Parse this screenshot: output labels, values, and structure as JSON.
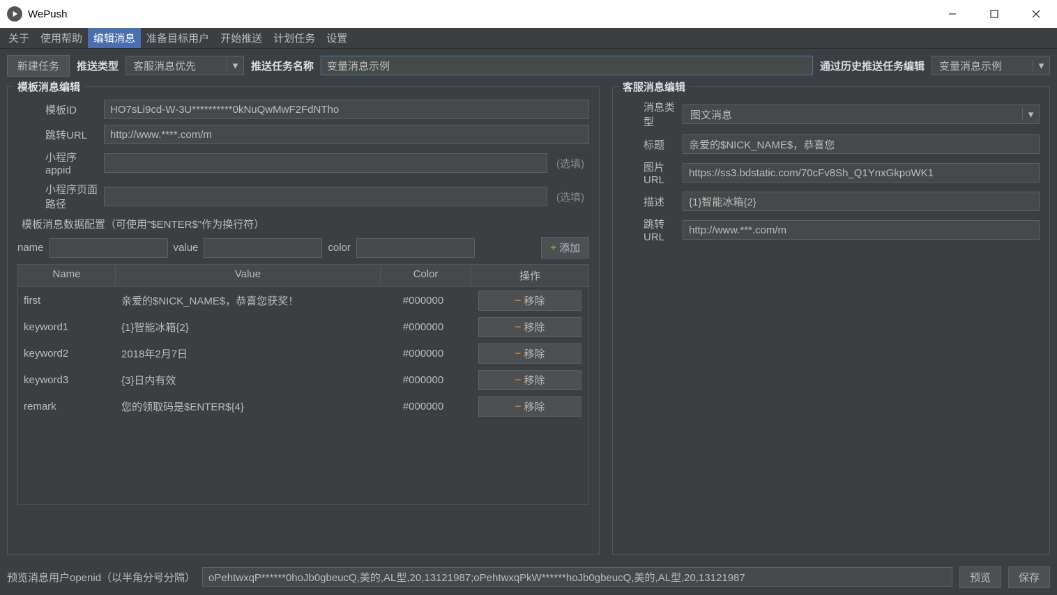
{
  "app": {
    "title": "WePush"
  },
  "menu": {
    "items": [
      "关于",
      "使用帮助",
      "编辑消息",
      "准备目标用户",
      "开始推送",
      "计划任务",
      "设置"
    ],
    "activeIndex": 2
  },
  "toolbar": {
    "new_task": "新建任务",
    "push_type_label": "推送类型",
    "push_type_value": "客服消息优先",
    "task_name_label": "推送任务名称",
    "task_name_value": "变量消息示例",
    "history_label": "通过历史推送任务编辑",
    "history_value": "变量消息示例"
  },
  "template_panel": {
    "title": "模板消息编辑",
    "template_id_label": "模板ID",
    "template_id_value": "HO7sLi9cd-W-3U**********0kNuQwMwF2FdNTho",
    "redirect_url_label": "跳转URL",
    "redirect_url_value": "http://www.****.com/m",
    "mini_appid_label": "小程序appid",
    "mini_appid_value": "",
    "mini_appid_hint": "(选填)",
    "mini_path_label": "小程序页面路径",
    "mini_path_value": "",
    "mini_path_hint": "(选填)",
    "config_title": "模板消息数据配置（可使用\"$ENTER$\"作为换行符）",
    "name_label": "name",
    "value_label": "value",
    "color_label": "color",
    "add_btn": "添加",
    "table": {
      "headers": {
        "name": "Name",
        "value": "Value",
        "color": "Color",
        "op": "操作"
      },
      "remove_label": "移除",
      "rows": [
        {
          "name": "first",
          "value": "亲爱的$NICK_NAME$，恭喜您获奖！",
          "color": "#000000"
        },
        {
          "name": "keyword1",
          "value": "{1}智能冰箱{2}",
          "color": "#000000"
        },
        {
          "name": "keyword2",
          "value": "2018年2月7日",
          "color": "#000000"
        },
        {
          "name": "keyword3",
          "value": "{3}日内有效",
          "color": "#000000"
        },
        {
          "name": "remark",
          "value": "您的领取码是$ENTER${4}",
          "color": "#000000"
        }
      ]
    }
  },
  "service_panel": {
    "title": "客服消息编辑",
    "msg_type_label": "消息类型",
    "msg_type_value": "图文消息",
    "title_label": "标题",
    "title_value": "亲爱的$NICK_NAME$，恭喜您",
    "pic_url_label": "图片URL",
    "pic_url_value": "https://ss3.bdstatic.com/70cFv8Sh_Q1YnxGkpoWK1",
    "desc_label": "描述",
    "desc_value": "{1}智能冰箱{2}",
    "redirect_url_label": "跳转URL",
    "redirect_url_value": "http://www.***.com/m"
  },
  "bottom": {
    "openid_label": "预览消息用户openid（以半角分号分隔）",
    "openid_value": "oPehtwxqP******0hoJb0gbeucQ,美的,AL型,20,13121987;oPehtwxqPkW******hoJb0gbeucQ,美的,AL型,20,13121987",
    "preview": "预览",
    "save": "保存"
  }
}
